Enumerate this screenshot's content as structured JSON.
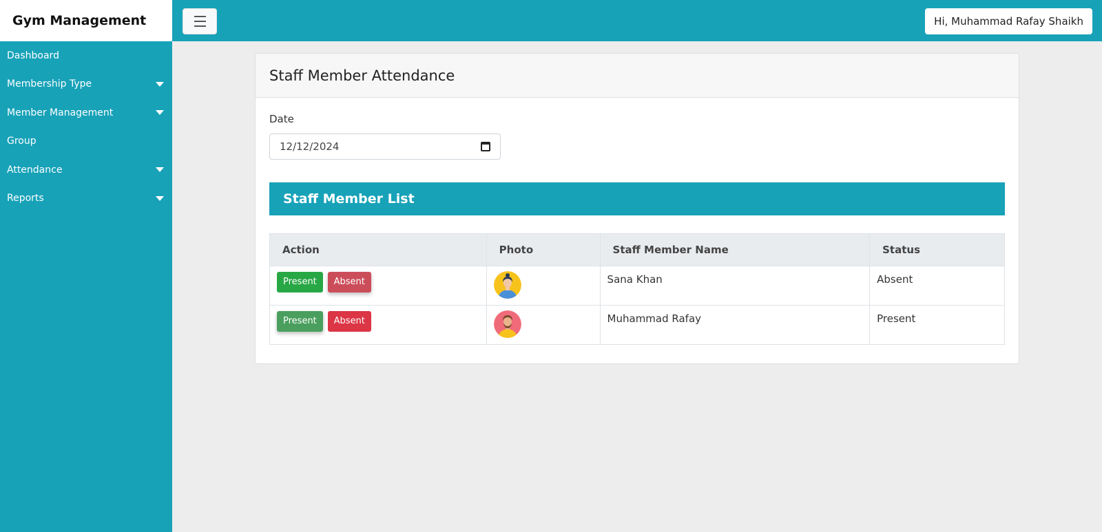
{
  "app": {
    "title": "Gym Management"
  },
  "header": {
    "user_greeting": "Hi, Muhammad Rafay Shaikh"
  },
  "sidebar": {
    "items": [
      {
        "label": "Dashboard",
        "has_submenu": false
      },
      {
        "label": "Membership Type",
        "has_submenu": true
      },
      {
        "label": "Member Management",
        "has_submenu": true
      },
      {
        "label": "Group",
        "has_submenu": false
      },
      {
        "label": "Attendance",
        "has_submenu": true
      },
      {
        "label": "Reports",
        "has_submenu": true
      }
    ]
  },
  "main": {
    "title": "Staff Member Attendance",
    "date_label": "Date",
    "date_value": "12/12/2024",
    "list_title": "Staff Member List",
    "table": {
      "headers": [
        "Action",
        "Photo",
        "Staff Member Name",
        "Status"
      ],
      "rows": [
        {
          "present_label": "Present",
          "absent_label": "Absent",
          "avatar": "female-avatar-icon",
          "name": "Sana Khan",
          "status": "Absent"
        },
        {
          "present_label": "Present",
          "absent_label": "Absent",
          "avatar": "male-avatar-icon",
          "name": "Muhammad Rafay",
          "status": "Present"
        }
      ]
    }
  },
  "colors": {
    "accent": "#17a2b8",
    "present": "#28a745",
    "absent": "#dc3545"
  }
}
